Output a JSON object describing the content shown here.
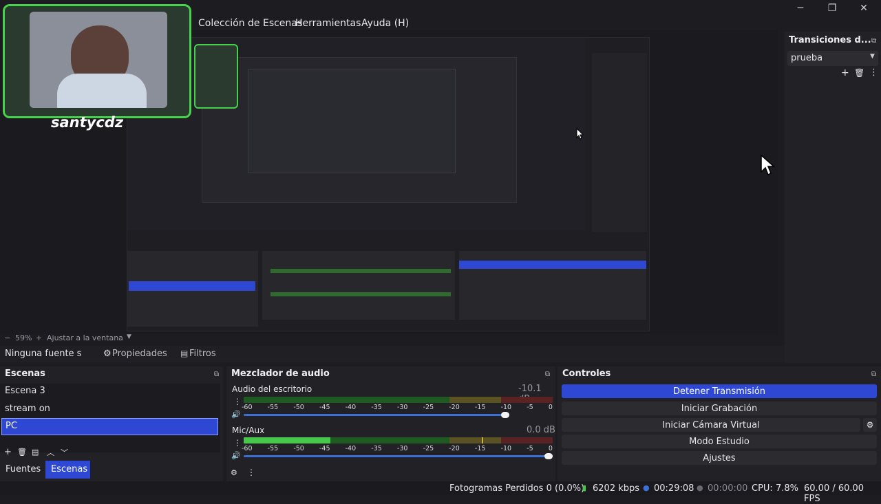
{
  "menu": {
    "collection": "Colección de Escenas",
    "tools": "Herramientas",
    "help": "Ayuda (H)"
  },
  "window_controls": {
    "minimize": "─",
    "maximize": "❐",
    "close": "✕"
  },
  "webcam": {
    "name": "santycdz"
  },
  "transitions": {
    "title": "Transiciones d...",
    "selected": "prueba"
  },
  "zoom_bar": {
    "zoom": "59%",
    "fit": "Ajustar a la ventana"
  },
  "source_bar": {
    "no_source": "Ninguna fuente s",
    "properties": "Propiedades",
    "filters": "Filtros"
  },
  "scenes": {
    "title": "Escenas",
    "items": [
      "Escena 3",
      "stream on",
      "PC"
    ],
    "selected_index": 2,
    "tab_sources": "Fuentes",
    "tab_scenes": "Escenas"
  },
  "mixer": {
    "title": "Mezclador de audio",
    "channels": [
      {
        "name": "Audio del escritorio",
        "db": "-10.1 dB",
        "level": 0.0,
        "volume": 0.86
      },
      {
        "name": "Mic/Aux",
        "db": "0.0 dB",
        "level": 0.28,
        "peak": 0.77,
        "volume": 1.0
      }
    ],
    "ticks": [
      "-60",
      "-55",
      "-50",
      "-45",
      "-40",
      "-35",
      "-30",
      "-25",
      "-20",
      "-15",
      "-10",
      "-5",
      "0"
    ]
  },
  "controls": {
    "title": "Controles",
    "stop_stream": "Detener Transmisión",
    "start_recording": "Iniciar Grabación",
    "start_virtual_cam": "Iniciar Cámara Virtual",
    "studio_mode": "Modo Estudio",
    "settings": "Ajustes"
  },
  "status": {
    "dropped": "Fotogramas Perdidos 0 (0.0%)",
    "bitrate": "6202 kbps",
    "stream_time": "00:29:08",
    "rec_time": "00:00:00",
    "cpu": "CPU: 7.8%",
    "fps": "60.00 / 60.00 FPS"
  },
  "colors": {
    "accent": "#2f48d4",
    "meter_green": "#48c84a",
    "meter_yellow": "#c8b43a",
    "meter_red": "#c83a3a"
  }
}
